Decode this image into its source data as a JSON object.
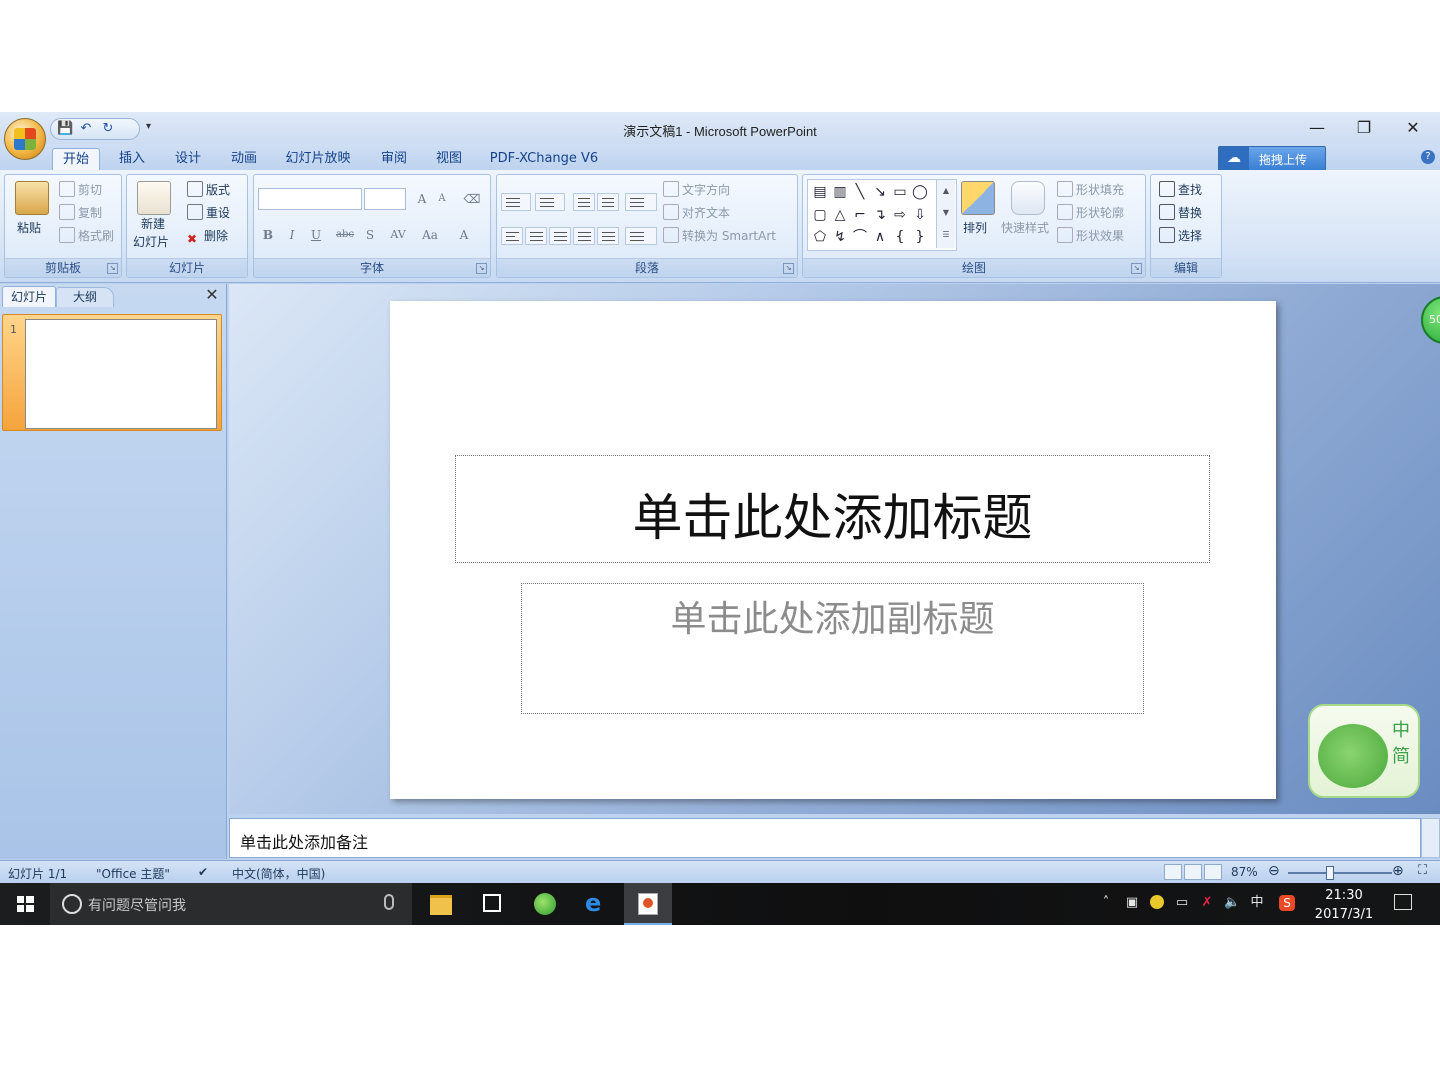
{
  "window": {
    "title": "演示文稿1 - Microsoft PowerPoint",
    "controls": [
      "—",
      "❐",
      "✕"
    ]
  },
  "qat": {
    "more_glyph": "▾"
  },
  "tabs": [
    {
      "label": "开始",
      "active": true
    },
    {
      "label": "插入"
    },
    {
      "label": "设计"
    },
    {
      "label": "动画"
    },
    {
      "label": "幻灯片放映"
    },
    {
      "label": "审阅"
    },
    {
      "label": "视图"
    },
    {
      "label": "PDF-XChange V6"
    }
  ],
  "upload_button": "拖拽上传",
  "help_glyph": "?",
  "ribbon": {
    "clipboard": {
      "title": "剪贴板",
      "paste": "粘贴",
      "cut": "剪切",
      "copy": "复制",
      "format_painter": "格式刷"
    },
    "slides": {
      "title": "幻灯片",
      "new_slide_1": "新建",
      "new_slide_2": "幻灯片",
      "layout": "版式",
      "reset": "重设",
      "delete": "删除"
    },
    "font": {
      "title": "字体",
      "bold": "B",
      "italic": "I",
      "underline": "U",
      "strike": "abc",
      "shadow": "S",
      "spacing": "AV",
      "case": "Aa",
      "color": "A",
      "grow": "A",
      "shrink": "A"
    },
    "paragraph": {
      "title": "段落",
      "text_direction": "文字方向",
      "align_text": "对齐文本",
      "smartart": "转换为 SmartArt"
    },
    "drawing": {
      "title": "绘图",
      "arrange": "排列",
      "quick_styles": "快速样式",
      "shape_fill": "形状填充",
      "shape_outline": "形状轮廓",
      "shape_effects": "形状效果"
    },
    "editing": {
      "title": "编辑",
      "find": "查找",
      "replace": "替换",
      "select": "选择"
    }
  },
  "left_pane": {
    "tab_slides": "幻灯片",
    "tab_outline": "大纲",
    "close_glyph": "✕",
    "thumb_number": "1"
  },
  "slide": {
    "title_placeholder": "单击此处添加标题",
    "subtitle_placeholder": "单击此处添加副标题"
  },
  "badge": "50",
  "ime": {
    "char1": "中",
    "char2": "简"
  },
  "notes_placeholder": "单击此处添加备注",
  "status": {
    "slide_count": "幻灯片 1/1",
    "theme": "\"Office 主题\"",
    "language": "中文(简体，中国)",
    "zoom": "87%"
  },
  "taskbar": {
    "search_placeholder": "有问题尽管问我",
    "ime_indicator": "中",
    "time": "21:30",
    "date": "2017/3/1"
  }
}
